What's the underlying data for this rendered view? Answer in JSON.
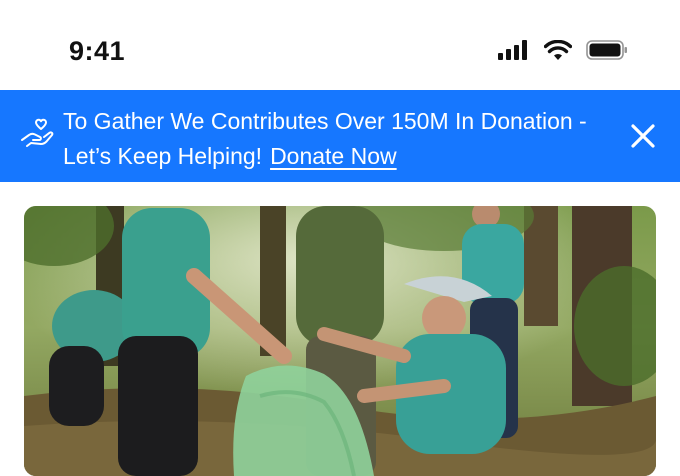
{
  "status_bar": {
    "time": "9:41",
    "icons": [
      "signal-icon",
      "wifi-icon",
      "battery-icon"
    ]
  },
  "banner": {
    "text": "To Gather We Contributes Over 150M In Donation - Let’s Keep Helping!",
    "link_label": "Donate Now",
    "icon": "hand-heart-icon",
    "close_icon": "close-icon",
    "background_color": "#1677ff"
  },
  "hero": {
    "image": "volunteers-cleanup-photo"
  }
}
